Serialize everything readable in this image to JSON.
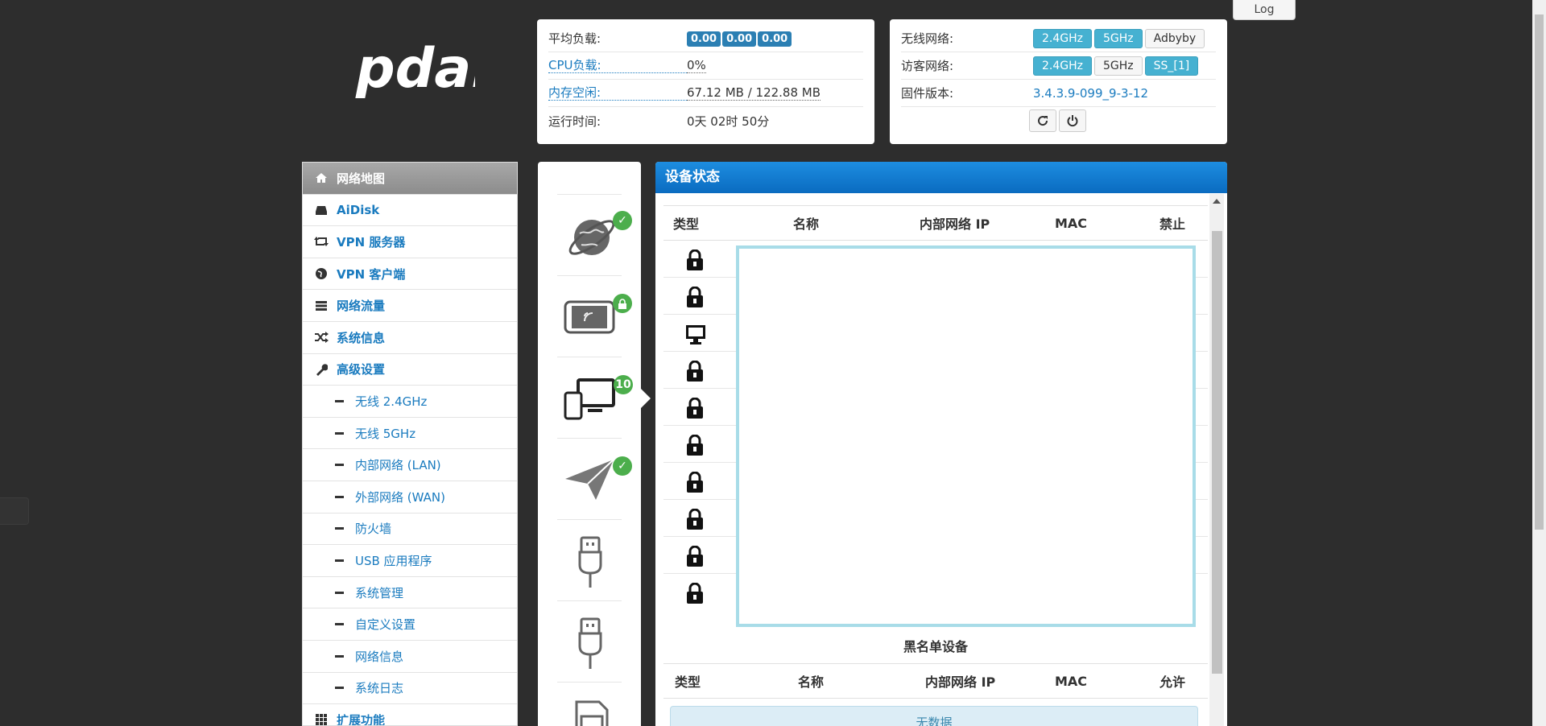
{
  "header": {
    "log_tab": "Log",
    "logo_text": "pdan"
  },
  "status": {
    "load_label": "平均负载:",
    "load_values": [
      "0.00",
      "0.00",
      "0.00"
    ],
    "cpu_label": "CPU负载:",
    "cpu_value": "0%",
    "mem_label": "内存空闲:",
    "mem_value": "67.12 MB / 122.88 MB",
    "uptime_label": "运行时间:",
    "uptime_value": "0天 02时 50分"
  },
  "wireless": {
    "wifi_label": "无线网络:",
    "wifi_buttons": [
      "2.4GHz",
      "5GHz",
      "Adbyby"
    ],
    "guest_label": "访客网络:",
    "guest_buttons": [
      "2.4GHz",
      "5GHz",
      "SS_[1]"
    ],
    "fw_label": "固件版本:",
    "fw_value": "3.4.3.9-099_9-3-12"
  },
  "sidebar": {
    "items": [
      {
        "label": "网络地图",
        "icon": "home-icon"
      },
      {
        "label": "AiDisk",
        "icon": "hdd-icon"
      },
      {
        "label": "VPN 服务器",
        "icon": "retweet-icon"
      },
      {
        "label": "VPN 客户端",
        "icon": "globe-icon"
      },
      {
        "label": "网络流量",
        "icon": "tasks-icon"
      },
      {
        "label": "系统信息",
        "icon": "random-icon"
      },
      {
        "label": "高级设置",
        "icon": "wrench-icon"
      }
    ],
    "sub_items": [
      "无线 2.4GHz",
      "无线 5GHz",
      "内部网络 (LAN)",
      "外部网络 (WAN)",
      "防火墙",
      "USB 应用程序",
      "系统管理",
      "自定义设置",
      "网络信息",
      "系统日志"
    ],
    "extra": {
      "label": "扩展功能",
      "icon": "grid-icon"
    }
  },
  "iconcol": {
    "client_count": "10"
  },
  "main": {
    "title": "设备状态",
    "columns": [
      "类型",
      "名称",
      "内部网络 IP",
      "MAC",
      "禁止"
    ],
    "blacklist_title": "黑名单设备",
    "blacklist_columns": [
      "类型",
      "名称",
      "内部网络 IP",
      "MAC",
      "允许"
    ],
    "no_data": "无数据"
  },
  "colors": {
    "accent": "#1a7bbf",
    "header_blue": "#0a6bc0",
    "badge": "#2b7fb3",
    "toggle_on": "#46b1d1",
    "check_green": "#4cae4c"
  }
}
